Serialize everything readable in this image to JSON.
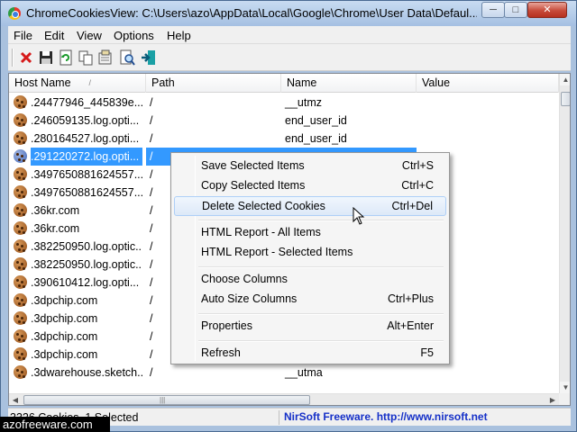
{
  "window": {
    "title": "ChromeCookiesView:  C:\\Users\\azo\\AppData\\Local\\Google\\Chrome\\User Data\\Defaul...",
    "minimize": "─",
    "maximize": "□",
    "close": "✕"
  },
  "menu": [
    "File",
    "Edit",
    "View",
    "Options",
    "Help"
  ],
  "toolbar": {
    "icons": [
      "delete-icon",
      "save-icon",
      "refresh-icon",
      "copy-icon",
      "properties-icon",
      "find-icon",
      "exit-icon"
    ]
  },
  "columns": [
    {
      "label": "Host Name",
      "sort": "▲"
    },
    {
      "label": "Path"
    },
    {
      "label": "Name"
    },
    {
      "label": "Value"
    }
  ],
  "rows": [
    {
      "host": ".24477946_445839e...",
      "path": "/",
      "name": "__utmz"
    },
    {
      "host": ".246059135.log.opti...",
      "path": "/",
      "name": "end_user_id"
    },
    {
      "host": ".280164527.log.opti...",
      "path": "/",
      "name": "end_user_id"
    },
    {
      "host": ".291220272.log.opti...",
      "path": "/",
      "name": "",
      "selected": true
    },
    {
      "host": ".3497650881624557...",
      "path": "/",
      "name": ""
    },
    {
      "host": ".3497650881624557...",
      "path": "/",
      "name": ""
    },
    {
      "host": ".36kr.com",
      "path": "/",
      "name": ""
    },
    {
      "host": ".36kr.com",
      "path": "/",
      "name": ""
    },
    {
      "host": ".382250950.log.optic...",
      "path": "/",
      "name": ""
    },
    {
      "host": ".382250950.log.optic...",
      "path": "/",
      "name": ""
    },
    {
      "host": ".390610412.log.opti...",
      "path": "/",
      "name": ""
    },
    {
      "host": ".3dpchip.com",
      "path": "/",
      "name": ""
    },
    {
      "host": ".3dpchip.com",
      "path": "/",
      "name": ""
    },
    {
      "host": ".3dpchip.com",
      "path": "/",
      "name": ""
    },
    {
      "host": ".3dpchip.com",
      "path": "/",
      "name": ""
    },
    {
      "host": ".3dwarehouse.sketch...",
      "path": "/",
      "name": "__utma"
    }
  ],
  "context_menu": {
    "items": [
      {
        "label": "Save Selected Items",
        "shortcut": "Ctrl+S"
      },
      {
        "label": "Copy Selected Items",
        "shortcut": "Ctrl+C"
      },
      {
        "label": "Delete Selected Cookies",
        "shortcut": "Ctrl+Del",
        "hover": true
      },
      {
        "label": "HTML Report - All Items",
        "shortcut": ""
      },
      {
        "label": "HTML Report - Selected Items",
        "shortcut": ""
      },
      {
        "label": "Choose Columns",
        "shortcut": ""
      },
      {
        "label": "Auto Size Columns",
        "shortcut": "Ctrl+Plus"
      },
      {
        "label": "Properties",
        "shortcut": "Alt+Enter"
      },
      {
        "label": "Refresh",
        "shortcut": "F5"
      }
    ]
  },
  "status": {
    "count": "3326 Cookies, 1 Selected",
    "link": "NirSoft Freeware.  http://www.nirsoft.net"
  },
  "watermark": "azofreeware.com"
}
